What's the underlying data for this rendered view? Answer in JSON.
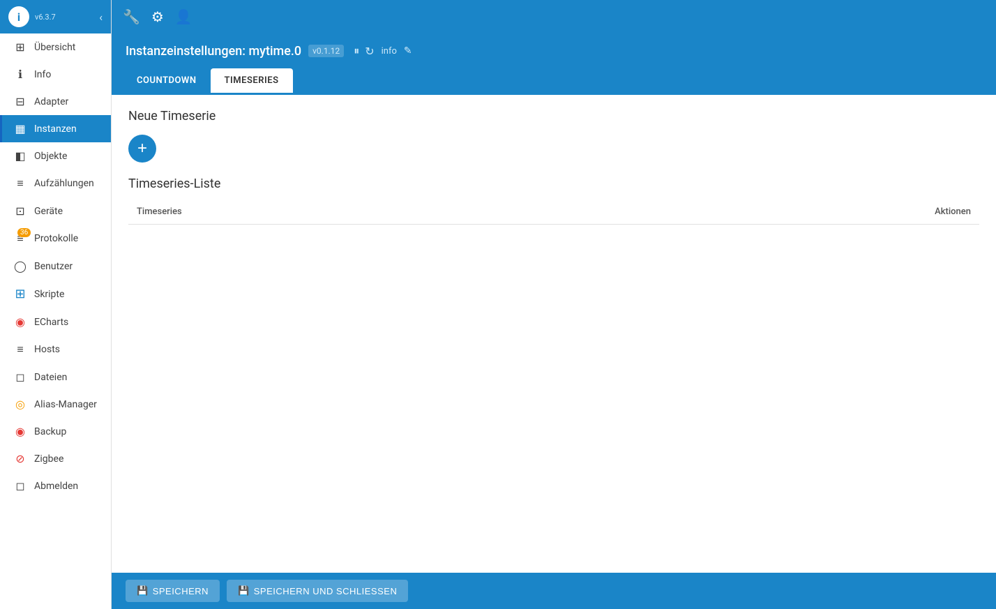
{
  "sidebar": {
    "logo_text": "i",
    "version": "v6.3.7",
    "collapse_icon": "‹",
    "items": [
      {
        "id": "uebersicht",
        "label": "Übersicht",
        "icon": "⊞"
      },
      {
        "id": "info",
        "label": "Info",
        "icon": "ℹ"
      },
      {
        "id": "adapter",
        "label": "Adapter",
        "icon": "⊟"
      },
      {
        "id": "instanzen",
        "label": "Instanzen",
        "icon": "▦",
        "active": true
      },
      {
        "id": "objekte",
        "label": "Objekte",
        "icon": "◧"
      },
      {
        "id": "aufzaehlungen",
        "label": "Aufzählungen",
        "icon": "≡"
      },
      {
        "id": "geraete",
        "label": "Geräte",
        "icon": "⊡"
      },
      {
        "id": "protokolle",
        "label": "Protokolle",
        "icon": "≡",
        "badge": "36"
      },
      {
        "id": "benutzer",
        "label": "Benutzer",
        "icon": "◯"
      },
      {
        "id": "skripte",
        "label": "Skripte",
        "icon": "⊞"
      },
      {
        "id": "echarts",
        "label": "ECharts",
        "icon": "◉"
      },
      {
        "id": "hosts",
        "label": "Hosts",
        "icon": "≡"
      },
      {
        "id": "dateien",
        "label": "Dateien",
        "icon": "◻"
      },
      {
        "id": "alias-manager",
        "label": "Alias-Manager",
        "icon": "◎"
      },
      {
        "id": "backup",
        "label": "Backup",
        "icon": "◉"
      },
      {
        "id": "zigbee",
        "label": "Zigbee",
        "icon": "⊘"
      },
      {
        "id": "abmelden",
        "label": "Abmelden",
        "icon": "◻"
      }
    ]
  },
  "toolbar": {
    "icons": [
      "wrench",
      "sun",
      "person"
    ]
  },
  "instance_header": {
    "title": "Instanzeinstellungen: mytime.0",
    "version": "v0.1.12",
    "info_label": "info"
  },
  "tabs": [
    {
      "id": "countdown",
      "label": "COUNTDOWN",
      "active": false
    },
    {
      "id": "timeseries",
      "label": "TIMESERIES",
      "active": true
    }
  ],
  "content": {
    "new_timeserie_label": "Neue Timeserie",
    "add_btn_label": "+",
    "list_title": "Timeseries-Liste",
    "table_col_timeseries": "Timeseries",
    "table_col_aktionen": "Aktionen"
  },
  "footer": {
    "save_label": "SPEICHERN",
    "save_close_label": "SPEICHERN UND SCHLIESSEN",
    "save_icon": "💾",
    "save_close_icon": "💾"
  }
}
